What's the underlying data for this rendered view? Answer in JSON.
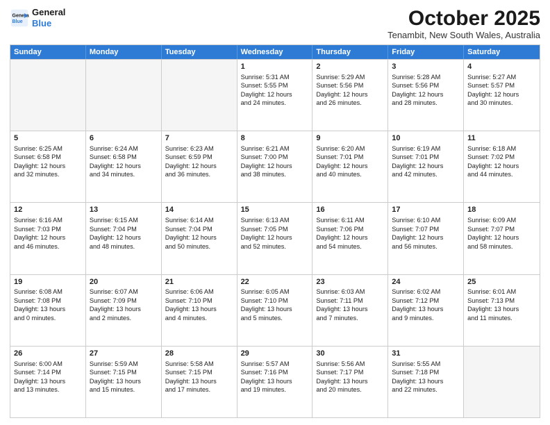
{
  "logo": {
    "line1": "General",
    "line2": "Blue"
  },
  "title": "October 2025",
  "location": "Tenambit, New South Wales, Australia",
  "days_of_week": [
    "Sunday",
    "Monday",
    "Tuesday",
    "Wednesday",
    "Thursday",
    "Friday",
    "Saturday"
  ],
  "rows": [
    [
      {
        "day": "",
        "content": "",
        "empty": true
      },
      {
        "day": "",
        "content": "",
        "empty": true
      },
      {
        "day": "",
        "content": "",
        "empty": true
      },
      {
        "day": "1",
        "content": "Sunrise: 5:31 AM\nSunset: 5:55 PM\nDaylight: 12 hours\nand 24 minutes.",
        "empty": false
      },
      {
        "day": "2",
        "content": "Sunrise: 5:29 AM\nSunset: 5:56 PM\nDaylight: 12 hours\nand 26 minutes.",
        "empty": false
      },
      {
        "day": "3",
        "content": "Sunrise: 5:28 AM\nSunset: 5:56 PM\nDaylight: 12 hours\nand 28 minutes.",
        "empty": false
      },
      {
        "day": "4",
        "content": "Sunrise: 5:27 AM\nSunset: 5:57 PM\nDaylight: 12 hours\nand 30 minutes.",
        "empty": false
      }
    ],
    [
      {
        "day": "5",
        "content": "Sunrise: 6:25 AM\nSunset: 6:58 PM\nDaylight: 12 hours\nand 32 minutes.",
        "empty": false
      },
      {
        "day": "6",
        "content": "Sunrise: 6:24 AM\nSunset: 6:58 PM\nDaylight: 12 hours\nand 34 minutes.",
        "empty": false
      },
      {
        "day": "7",
        "content": "Sunrise: 6:23 AM\nSunset: 6:59 PM\nDaylight: 12 hours\nand 36 minutes.",
        "empty": false
      },
      {
        "day": "8",
        "content": "Sunrise: 6:21 AM\nSunset: 7:00 PM\nDaylight: 12 hours\nand 38 minutes.",
        "empty": false
      },
      {
        "day": "9",
        "content": "Sunrise: 6:20 AM\nSunset: 7:01 PM\nDaylight: 12 hours\nand 40 minutes.",
        "empty": false
      },
      {
        "day": "10",
        "content": "Sunrise: 6:19 AM\nSunset: 7:01 PM\nDaylight: 12 hours\nand 42 minutes.",
        "empty": false
      },
      {
        "day": "11",
        "content": "Sunrise: 6:18 AM\nSunset: 7:02 PM\nDaylight: 12 hours\nand 44 minutes.",
        "empty": false
      }
    ],
    [
      {
        "day": "12",
        "content": "Sunrise: 6:16 AM\nSunset: 7:03 PM\nDaylight: 12 hours\nand 46 minutes.",
        "empty": false
      },
      {
        "day": "13",
        "content": "Sunrise: 6:15 AM\nSunset: 7:04 PM\nDaylight: 12 hours\nand 48 minutes.",
        "empty": false
      },
      {
        "day": "14",
        "content": "Sunrise: 6:14 AM\nSunset: 7:04 PM\nDaylight: 12 hours\nand 50 minutes.",
        "empty": false
      },
      {
        "day": "15",
        "content": "Sunrise: 6:13 AM\nSunset: 7:05 PM\nDaylight: 12 hours\nand 52 minutes.",
        "empty": false
      },
      {
        "day": "16",
        "content": "Sunrise: 6:11 AM\nSunset: 7:06 PM\nDaylight: 12 hours\nand 54 minutes.",
        "empty": false
      },
      {
        "day": "17",
        "content": "Sunrise: 6:10 AM\nSunset: 7:07 PM\nDaylight: 12 hours\nand 56 minutes.",
        "empty": false
      },
      {
        "day": "18",
        "content": "Sunrise: 6:09 AM\nSunset: 7:07 PM\nDaylight: 12 hours\nand 58 minutes.",
        "empty": false
      }
    ],
    [
      {
        "day": "19",
        "content": "Sunrise: 6:08 AM\nSunset: 7:08 PM\nDaylight: 13 hours\nand 0 minutes.",
        "empty": false
      },
      {
        "day": "20",
        "content": "Sunrise: 6:07 AM\nSunset: 7:09 PM\nDaylight: 13 hours\nand 2 minutes.",
        "empty": false
      },
      {
        "day": "21",
        "content": "Sunrise: 6:06 AM\nSunset: 7:10 PM\nDaylight: 13 hours\nand 4 minutes.",
        "empty": false
      },
      {
        "day": "22",
        "content": "Sunrise: 6:05 AM\nSunset: 7:10 PM\nDaylight: 13 hours\nand 5 minutes.",
        "empty": false
      },
      {
        "day": "23",
        "content": "Sunrise: 6:03 AM\nSunset: 7:11 PM\nDaylight: 13 hours\nand 7 minutes.",
        "empty": false
      },
      {
        "day": "24",
        "content": "Sunrise: 6:02 AM\nSunset: 7:12 PM\nDaylight: 13 hours\nand 9 minutes.",
        "empty": false
      },
      {
        "day": "25",
        "content": "Sunrise: 6:01 AM\nSunset: 7:13 PM\nDaylight: 13 hours\nand 11 minutes.",
        "empty": false
      }
    ],
    [
      {
        "day": "26",
        "content": "Sunrise: 6:00 AM\nSunset: 7:14 PM\nDaylight: 13 hours\nand 13 minutes.",
        "empty": false
      },
      {
        "day": "27",
        "content": "Sunrise: 5:59 AM\nSunset: 7:15 PM\nDaylight: 13 hours\nand 15 minutes.",
        "empty": false
      },
      {
        "day": "28",
        "content": "Sunrise: 5:58 AM\nSunset: 7:15 PM\nDaylight: 13 hours\nand 17 minutes.",
        "empty": false
      },
      {
        "day": "29",
        "content": "Sunrise: 5:57 AM\nSunset: 7:16 PM\nDaylight: 13 hours\nand 19 minutes.",
        "empty": false
      },
      {
        "day": "30",
        "content": "Sunrise: 5:56 AM\nSunset: 7:17 PM\nDaylight: 13 hours\nand 20 minutes.",
        "empty": false
      },
      {
        "day": "31",
        "content": "Sunrise: 5:55 AM\nSunset: 7:18 PM\nDaylight: 13 hours\nand 22 minutes.",
        "empty": false
      },
      {
        "day": "",
        "content": "",
        "empty": true
      }
    ]
  ]
}
